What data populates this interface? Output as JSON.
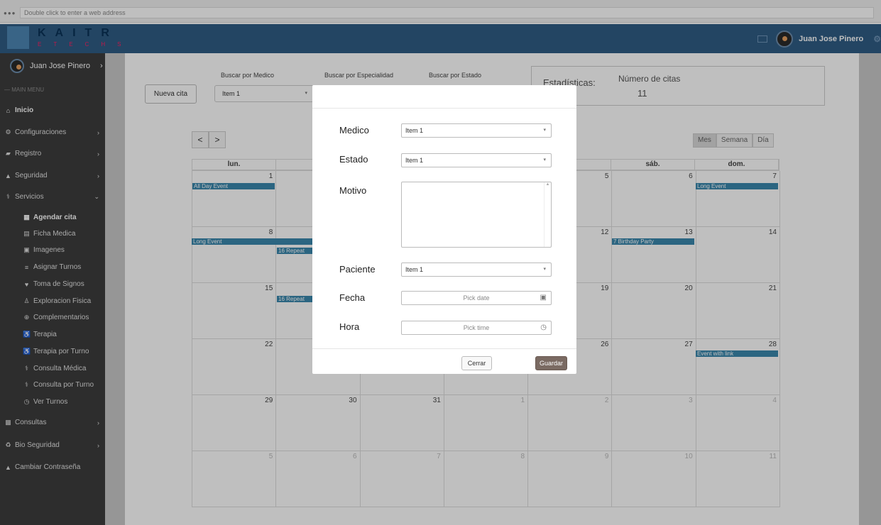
{
  "browser": {
    "address_placeholder": "Double click to enter a web address"
  },
  "brand": {
    "logo_top": "KAITR",
    "logo_bottom": "ETECHS"
  },
  "topbar": {
    "user_name": "Juan Jose Pinero"
  },
  "sidebar": {
    "profile_name": "Juan Jose Pinero",
    "menu_header": "— MAIN MENU",
    "items": [
      {
        "label": "Inicio",
        "icon": "home-icon"
      },
      {
        "label": "Configuraciones",
        "icon": "gear-icon"
      },
      {
        "label": "Registro",
        "icon": "book-icon"
      },
      {
        "label": "Seguridad",
        "icon": "lock-icon"
      },
      {
        "label": "Servicios",
        "icon": "stethoscope-icon"
      }
    ],
    "sub_items": [
      {
        "label": "Agendar cita",
        "icon": "calendar-icon"
      },
      {
        "label": "Ficha Medica",
        "icon": "file-icon"
      },
      {
        "label": "Imagenes",
        "icon": "image-icon"
      },
      {
        "label": "Asignar Turnos",
        "icon": "list-icon"
      },
      {
        "label": "Toma de Signos",
        "icon": "heartbeat-icon"
      },
      {
        "label": "Exploracion Fisica",
        "icon": "person-icon"
      },
      {
        "label": "Complementarios",
        "icon": "plus-circle-icon"
      },
      {
        "label": "Terapia",
        "icon": "wheelchair-icon"
      },
      {
        "label": "Terapia por Turno",
        "icon": "wheelchair-icon"
      },
      {
        "label": "Consulta Médica",
        "icon": "stethoscope-icon"
      },
      {
        "label": "Consulta por Turno",
        "icon": "stethoscope-icon"
      },
      {
        "label": "Ver Turnos",
        "icon": "clock-icon"
      }
    ],
    "bottom_items": [
      {
        "label": "Consultas",
        "icon": "briefcase-icon"
      },
      {
        "label": "Bio Seguridad",
        "icon": "recycle-icon"
      },
      {
        "label": "Cambiar Contraseña",
        "icon": "unlock-icon"
      }
    ]
  },
  "toolbar": {
    "new_button": "Nueva cita",
    "filter_medico_label": "Buscar por Medico",
    "filter_medico_value": "Item 1",
    "filter_especialidad_label": "Buscar por Especialidad",
    "filter_estado_label": "Buscar por Estado"
  },
  "stats": {
    "label": "Estadísticas:",
    "count_label": "Número de citas",
    "count_value": "11"
  },
  "calendar": {
    "prev": "<",
    "next": ">",
    "views": [
      "Mes",
      "Semana",
      "Día"
    ],
    "headers": [
      "lun.",
      "",
      "",
      "",
      "",
      "sáb.",
      "dom."
    ],
    "weeks": [
      [
        "1",
        "",
        "",
        "",
        "5",
        "6",
        "7"
      ],
      [
        "8",
        "",
        "",
        "",
        "12",
        "13",
        "14"
      ],
      [
        "15",
        "",
        "",
        "",
        "19",
        "20",
        "21"
      ],
      [
        "22",
        "",
        "",
        "",
        "26",
        "27",
        "28"
      ],
      [
        "29",
        "30",
        "31",
        "1",
        "2",
        "3",
        "4"
      ],
      [
        "5",
        "6",
        "7",
        "8",
        "9",
        "10",
        "11"
      ]
    ],
    "events": {
      "all_day": "All Day Event",
      "long_event": "Long Event",
      "long_event_2": "Long Event",
      "repeating_1": "16 Repeat",
      "repeating_2": "16 Repeat",
      "birthday": "7 Birthday Party",
      "link": "Event with link"
    }
  },
  "modal": {
    "medico_label": "Medico",
    "medico_value": "Item 1",
    "estado_label": "Estado",
    "estado_value": "Item 1",
    "motivo_label": "Motivo",
    "paciente_label": "Paciente",
    "paciente_value": "Item 1",
    "fecha_label": "Fecha",
    "fecha_placeholder": "Pick date",
    "hora_label": "Hora",
    "hora_placeholder": "Pick time",
    "close_button": "Cerrar",
    "save_button": "Guardar"
  },
  "colors": {
    "accent": "#2f5d85",
    "event": "#3a87ad",
    "save": "#7a6a62"
  }
}
